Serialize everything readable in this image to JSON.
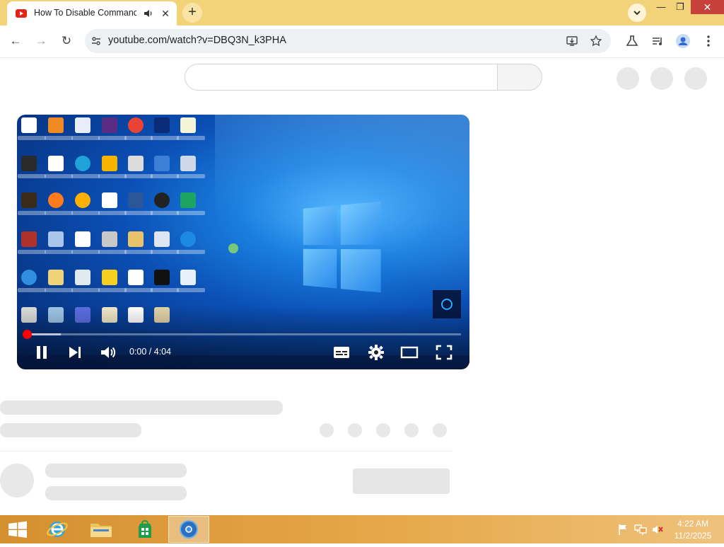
{
  "browser": {
    "tab": {
      "title": "How To Disable Command P",
      "audio_icon": "speaker-icon",
      "close_label": "✕"
    },
    "new_tab_label": "+",
    "window": {
      "minimize": "—",
      "restore": "❐",
      "close": "✕"
    },
    "toolbar": {
      "back": "←",
      "forward": "→",
      "reload": "↻"
    },
    "url": "youtube.com/watch?v=DBQ3N_k3PHA",
    "accent": "#f2d37a"
  },
  "player": {
    "time": "0:00 / 4:04",
    "progress_fraction": 0.0,
    "playing": true,
    "controls": [
      "pause-icon",
      "next-icon",
      "volume-icon",
      "captions-icon",
      "settings-icon",
      "theater-icon",
      "fullscreen-icon"
    ]
  },
  "taskbar": {
    "apps": [
      "windows-start-icon",
      "internet-explorer-icon",
      "file-explorer-icon",
      "store-icon",
      "chrome-icon"
    ],
    "tray": [
      "flag-icon",
      "network-icon",
      "volume-muted-icon"
    ],
    "time": "4:22 AM",
    "date": "11/2/2025"
  }
}
